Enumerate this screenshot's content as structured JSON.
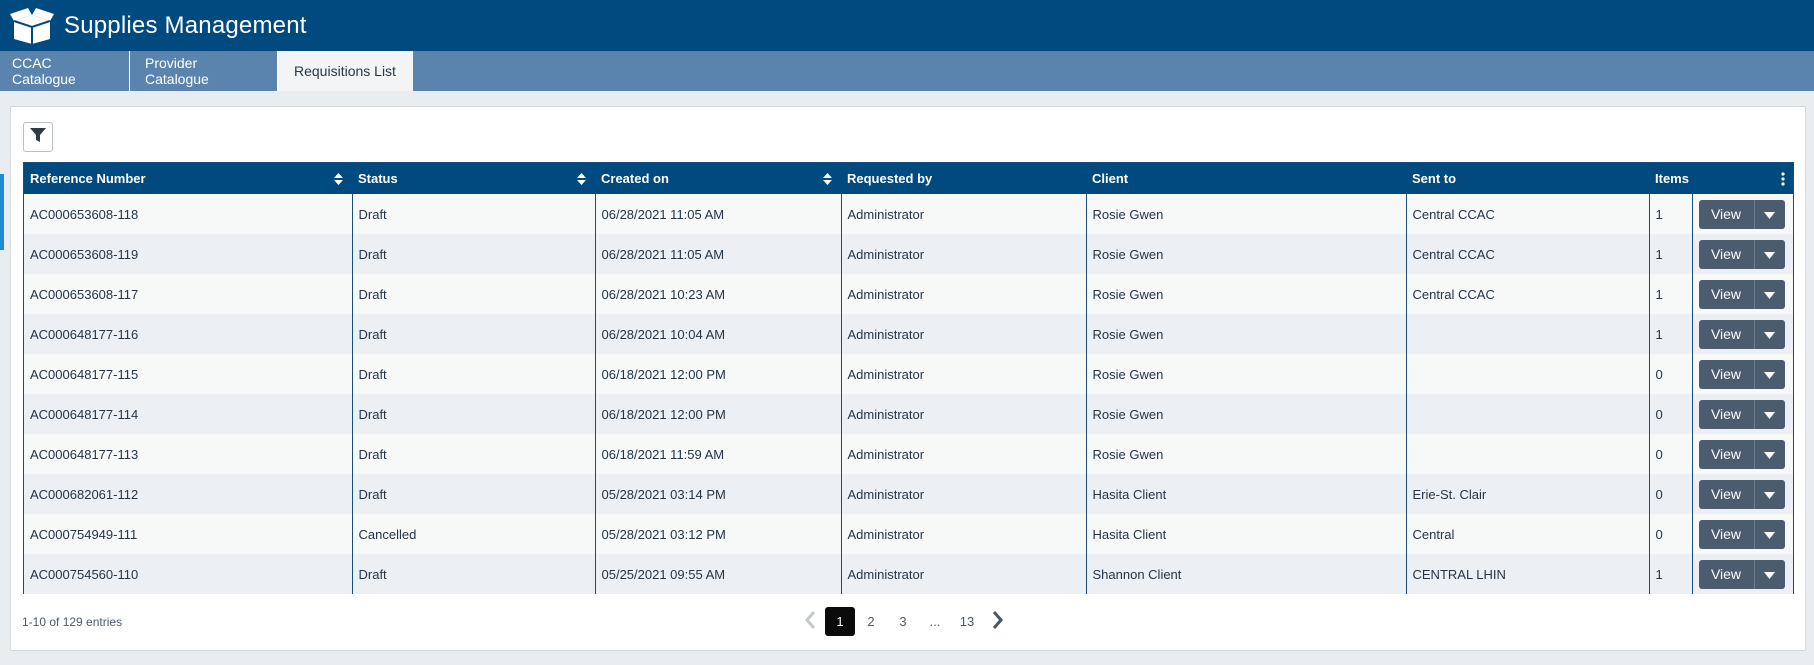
{
  "app": {
    "title": "Supplies Management"
  },
  "tabs": [
    {
      "label": "CCAC Catalogue"
    },
    {
      "label": "Provider Catalogue"
    },
    {
      "label": "Requisitions List"
    }
  ],
  "table": {
    "columns": [
      "Reference Number",
      "Status",
      "Created on",
      "Requested by",
      "Client",
      "Sent to",
      "Items"
    ],
    "rows": [
      {
        "ref": "AC000653608-118",
        "status": "Draft",
        "created": "06/28/2021 11:05 AM",
        "requested_by": "Administrator",
        "client": "Rosie Gwen",
        "sent_to": "Central CCAC",
        "items": "1",
        "action": "View"
      },
      {
        "ref": "AC000653608-119",
        "status": "Draft",
        "created": "06/28/2021 11:05 AM",
        "requested_by": "Administrator",
        "client": "Rosie Gwen",
        "sent_to": "Central CCAC",
        "items": "1",
        "action": "View"
      },
      {
        "ref": "AC000653608-117",
        "status": "Draft",
        "created": "06/28/2021 10:23 AM",
        "requested_by": "Administrator",
        "client": "Rosie Gwen",
        "sent_to": "Central CCAC",
        "items": "1",
        "action": "View"
      },
      {
        "ref": "AC000648177-116",
        "status": "Draft",
        "created": "06/28/2021 10:04 AM",
        "requested_by": "Administrator",
        "client": "Rosie Gwen",
        "sent_to": "",
        "items": "1",
        "action": "View"
      },
      {
        "ref": "AC000648177-115",
        "status": "Draft",
        "created": "06/18/2021 12:00 PM",
        "requested_by": "Administrator",
        "client": "Rosie Gwen",
        "sent_to": "",
        "items": "0",
        "action": "View"
      },
      {
        "ref": "AC000648177-114",
        "status": "Draft",
        "created": "06/18/2021 12:00 PM",
        "requested_by": "Administrator",
        "client": "Rosie Gwen",
        "sent_to": "",
        "items": "0",
        "action": "View"
      },
      {
        "ref": "AC000648177-113",
        "status": "Draft",
        "created": "06/18/2021 11:59 AM",
        "requested_by": "Administrator",
        "client": "Rosie Gwen",
        "sent_to": "",
        "items": "0",
        "action": "View"
      },
      {
        "ref": "AC000682061-112",
        "status": "Draft",
        "created": "05/28/2021 03:14 PM",
        "requested_by": "Administrator",
        "client": "Hasita Client",
        "sent_to": "Erie-St. Clair",
        "items": "0",
        "action": "View"
      },
      {
        "ref": "AC000754949-111",
        "status": "Cancelled",
        "created": "05/28/2021 03:12 PM",
        "requested_by": "Administrator",
        "client": "Hasita Client",
        "sent_to": "Central",
        "items": "0",
        "action": "View"
      },
      {
        "ref": "AC000754560-110",
        "status": "Draft",
        "created": "05/25/2021 09:55 AM",
        "requested_by": "Administrator",
        "client": "Shannon Client",
        "sent_to": "CENTRAL LHIN",
        "items": "1",
        "action": "View"
      }
    ]
  },
  "footer": {
    "summary": "1-10 of 129 entries",
    "pages": [
      "1",
      "2",
      "3",
      "...",
      "13"
    ],
    "current_page": "1"
  },
  "icons": {
    "logo": "box-icon",
    "filter": "filter-icon",
    "sort": "sort-icon",
    "menu": "kebab-menu-icon",
    "prev": "chevron-left-icon",
    "next": "chevron-right-icon",
    "dropdown": "caret-down-icon"
  },
  "colors": {
    "header_bar": "#004a7f",
    "tab_bar": "#5a84ad",
    "button": "#4a5c6e",
    "current_page": "#0b0b0b"
  }
}
